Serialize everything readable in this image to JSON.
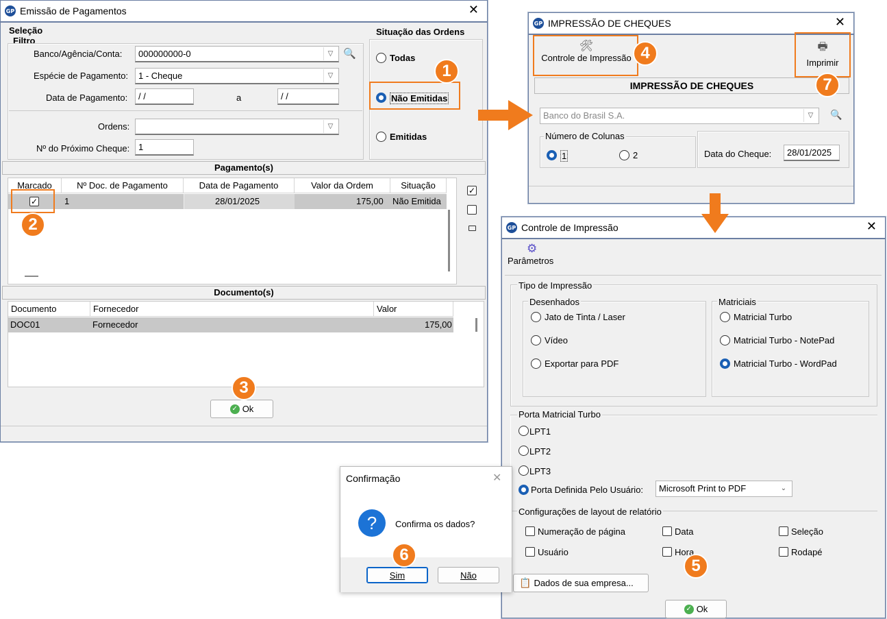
{
  "win1": {
    "title": "Emissão de Pagamentos",
    "selecao_label": "Seleção",
    "filtro_label": "Filtro",
    "banco_label": "Banco/Agência/Conta:",
    "banco_value": "000000000-0",
    "especie_label": "Espécie de Pagamento:",
    "especie_value": "1  -  Cheque",
    "data_label": "Data de Pagamento:",
    "data_from": " / /",
    "data_sep": "a",
    "data_to": " / /",
    "ordens_label": "Ordens:",
    "ordens_value": "",
    "prox_cheque_label": "Nº do Próximo Cheque:",
    "prox_cheque_value": "1",
    "situacao_label": "Situação das Ordens",
    "opt_todas": "Todas",
    "opt_nao_emitidas": "Não Emitidas",
    "opt_emitidas": "Emitidas",
    "pagamentos_title": "Pagamento(s)",
    "pag_cols": [
      "Marcado",
      "Nº Doc. de Pagamento",
      "Data de Pagamento",
      "Valor da Ordem",
      "Situação"
    ],
    "pag_row": {
      "doc": "1",
      "data": "28/01/2025",
      "valor": "175,00",
      "situacao": "Não Emitida"
    },
    "documentos_title": "Documento(s)",
    "doc_cols": [
      "Documento",
      "Fornecedor",
      "Valor"
    ],
    "doc_row": {
      "documento": "DOC01",
      "fornecedor": "Fornecedor",
      "valor": "175,00"
    },
    "ok_label": "Ok"
  },
  "win2": {
    "title": "IMPRESSÃO DE CHEQUES",
    "controle_btn": "Controle de Impressão",
    "imprimir_btn": "Imprimir",
    "header": "IMPRESSÃO DE CHEQUES",
    "banco_value": "Banco do Brasil S.A.",
    "colunas_label": "Número de Colunas",
    "col1": "1",
    "col2": "2",
    "data_cheque_label": "Data do Cheque:",
    "data_cheque_value": "28/01/2025"
  },
  "win3": {
    "title": "Controle de Impressão",
    "parametros": "Parâmetros",
    "tipo_label": "Tipo de Impressão",
    "desenhados_label": "Desenhados",
    "jato": "Jato de Tinta / Laser",
    "video": "Vídeo",
    "pdf": "Exportar para PDF",
    "matriciais_label": "Matriciais",
    "mt": "Matricial Turbo",
    "mt_notepad": "Matricial Turbo - NotePad",
    "mt_wordpad": "Matricial Turbo - WordPad",
    "porta_label": "Porta Matricial Turbo",
    "lpt1": "LPT1",
    "lpt2": "LPT2",
    "lpt3": "LPT3",
    "porta_usuario": "Porta Definida Pelo Usuário:",
    "porta_value": "Microsoft Print to PDF",
    "config_label": "Configurações de layout de relatório",
    "numeracao": "Numeração de página",
    "data": "Data",
    "selecao": "Seleção",
    "usuario": "Usuário",
    "hora": "Hora",
    "rodape": "Rodapé",
    "dados_empresa": "Dados de sua empresa...",
    "ok_label": "Ok"
  },
  "win4": {
    "title": "Confirmação",
    "message": "Confirma os dados?",
    "sim": "Sim",
    "nao": "Não"
  },
  "badges": [
    "1",
    "2",
    "3",
    "4",
    "5",
    "6",
    "7"
  ],
  "colors": {
    "accent": "#f07b1d",
    "selected_radio": "#1a5fb4",
    "window_border": "#6b7fa3"
  }
}
